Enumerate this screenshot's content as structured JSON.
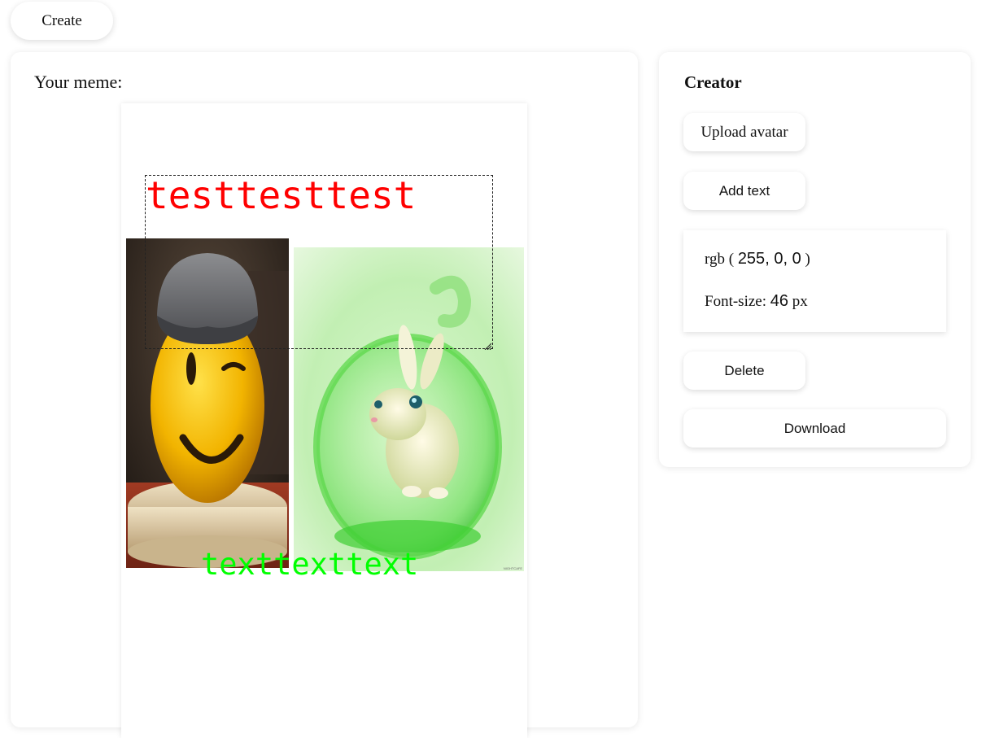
{
  "toolbar": {
    "create_label": "Create"
  },
  "meme": {
    "title": "Your meme:",
    "texts": [
      {
        "content": "testtesttest",
        "color": "#ff0000"
      },
      {
        "content": "texttexttext",
        "color": "#00ff00"
      }
    ],
    "images": [
      {
        "name": "smiley-avatar"
      },
      {
        "name": "bunny-avatar",
        "watermark": "NIGHTCAFE"
      }
    ]
  },
  "creator": {
    "title": "Creator",
    "upload_label": "Upload avatar",
    "add_text_label": "Add text",
    "color": {
      "prefix": "rgb (",
      "r": "255",
      "g": "0",
      "b": "0",
      "suffix": ")"
    },
    "font_size": {
      "label": "Font-size:",
      "value": "46",
      "unit": "px"
    },
    "delete_label": "Delete",
    "download_label": "Download"
  }
}
